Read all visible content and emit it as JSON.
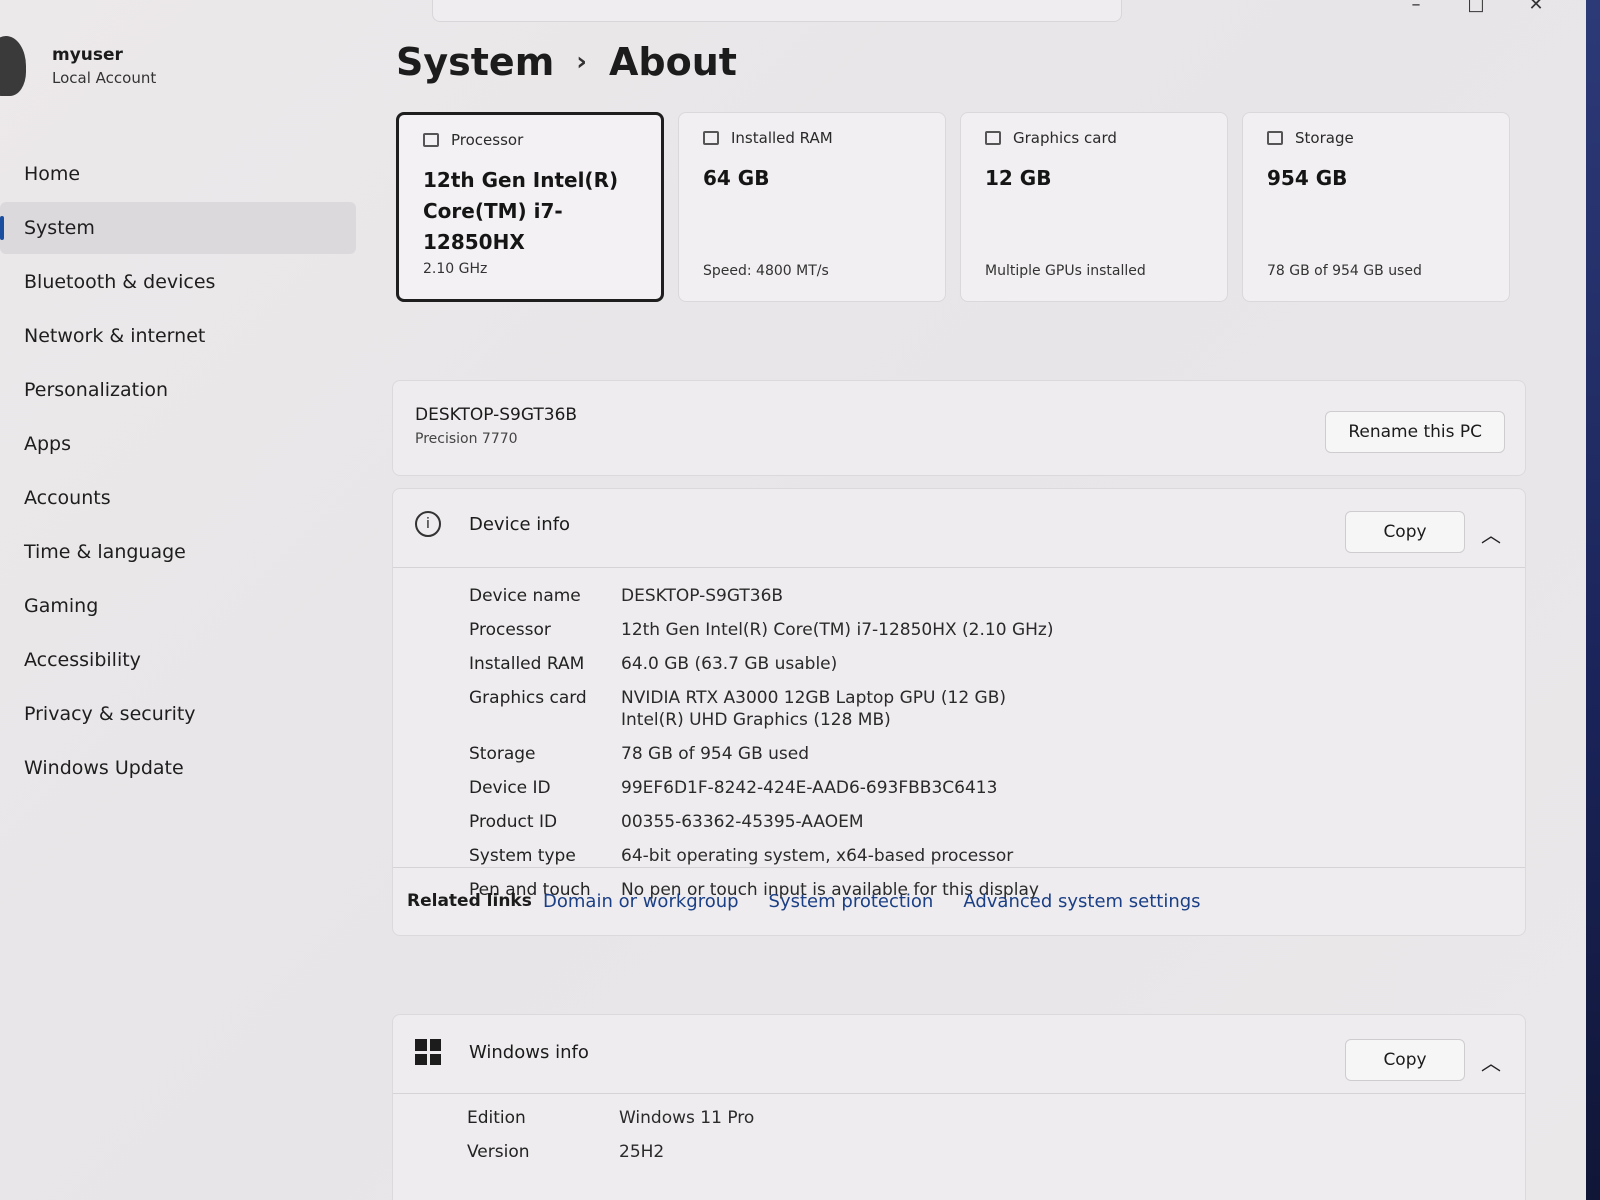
{
  "user": {
    "name": "myuser",
    "account_type": "Local Account"
  },
  "nav": {
    "items": [
      {
        "label": "Home"
      },
      {
        "label": "System"
      },
      {
        "label": "Bluetooth & devices"
      },
      {
        "label": "Network & internet"
      },
      {
        "label": "Personalization"
      },
      {
        "label": "Apps"
      },
      {
        "label": "Accounts"
      },
      {
        "label": "Time & language"
      },
      {
        "label": "Gaming"
      },
      {
        "label": "Accessibility"
      },
      {
        "label": "Privacy & security"
      },
      {
        "label": "Windows Update"
      }
    ],
    "active": "System"
  },
  "breadcrumb": {
    "parent": "System",
    "separator": "›",
    "current": "About"
  },
  "cards": [
    {
      "title": "Processor",
      "icon": "processor-icon",
      "value": "12th Gen Intel(R) Core(TM) i7-12850HX",
      "sub": "2.10 GHz"
    },
    {
      "title": "Installed RAM",
      "icon": "ram-icon",
      "value": "64 GB",
      "sub": "Speed: 4800 MT/s"
    },
    {
      "title": "Graphics card",
      "icon": "graphics-icon",
      "value": "12 GB",
      "sub": "Multiple GPUs installed"
    },
    {
      "title": "Storage",
      "icon": "storage-icon",
      "value": "954 GB",
      "sub": "78 GB of 954 GB used"
    }
  ],
  "pc": {
    "name": "DESKTOP-S9GT36B",
    "model": "Precision 7770",
    "rename_label": "Rename this PC"
  },
  "device_info": {
    "title": "Device info",
    "copy_label": "Copy",
    "rows": [
      {
        "key": "Device name",
        "value": "DESKTOP-S9GT36B"
      },
      {
        "key": "Processor",
        "value": "12th Gen Intel(R) Core(TM) i7-12850HX (2.10 GHz)"
      },
      {
        "key": "Installed RAM",
        "value": "64.0 GB (63.7 GB usable)"
      },
      {
        "key": "Graphics card",
        "value": "NVIDIA RTX A3000 12GB Laptop GPU (12 GB)",
        "value2": "Intel(R) UHD Graphics (128 MB)"
      },
      {
        "key": "Storage",
        "value": "78 GB of 954 GB used"
      },
      {
        "key": "Device ID",
        "value": "99EF6D1F-8242-424E-AAD6-693FBB3C6413"
      },
      {
        "key": "Product ID",
        "value": "00355-63362-45395-AAOEM"
      },
      {
        "key": "System type",
        "value": "64-bit operating system, x64-based processor"
      },
      {
        "key": "Pen and touch",
        "value": "No pen or touch input is available for this display"
      }
    ]
  },
  "related_links": {
    "label": "Related links",
    "links": [
      "Domain or workgroup",
      "System protection",
      "Advanced system settings"
    ]
  },
  "windows_info": {
    "title": "Windows info",
    "copy_label": "Copy",
    "rows": [
      {
        "key": "Edition",
        "value": "Windows 11 Pro"
      },
      {
        "key": "Version",
        "value": "25H2"
      }
    ]
  }
}
